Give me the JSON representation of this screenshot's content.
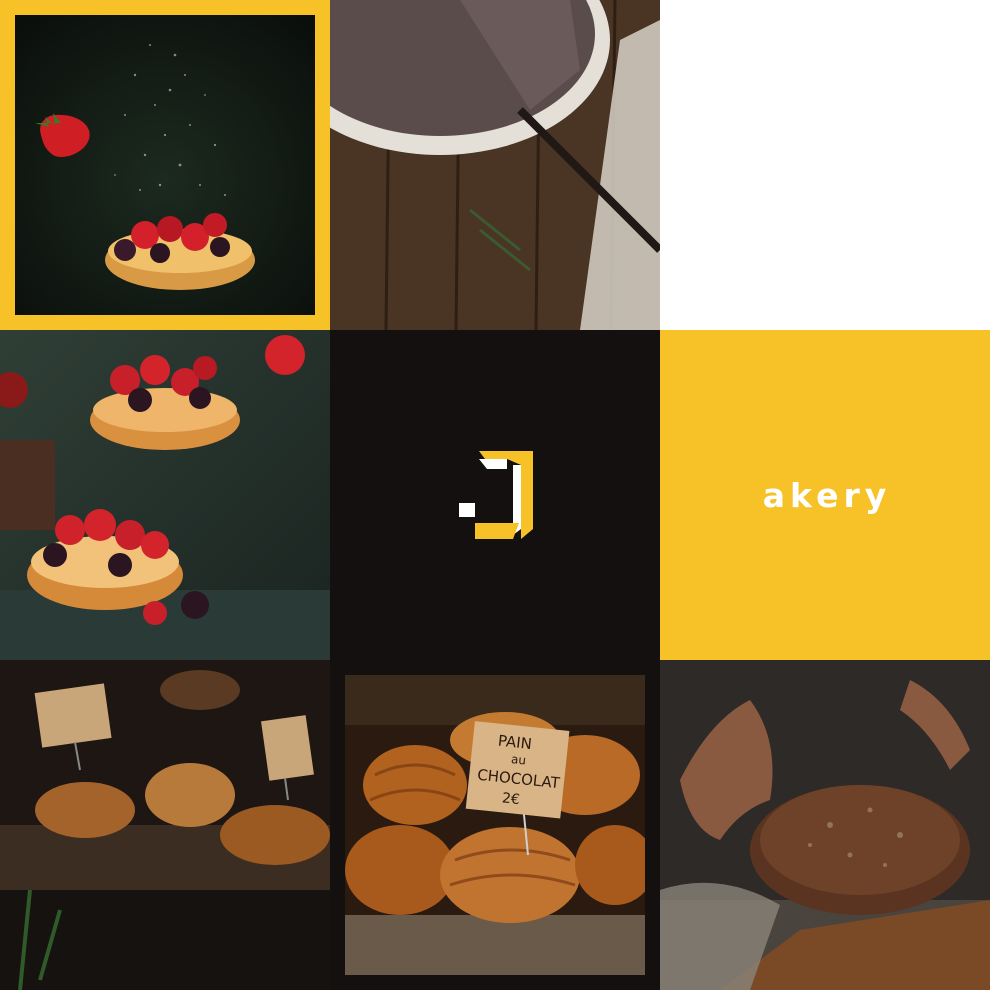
{
  "brand": {
    "name": "akery",
    "logo_icon": "j-monogram-icon",
    "accent_color": "#f6c227",
    "dark_color": "#141010"
  },
  "tiles": {
    "strawberry_tart": {
      "icon": "strawberry-tart-photo"
    },
    "chocolate_cake": {
      "icon": "chocolate-cake-photo"
    },
    "blank": {
      "icon": "blank-white-tile"
    },
    "berry_tarts": {
      "icon": "berry-tarts-photo"
    },
    "logo": {
      "icon": "logo-tile"
    },
    "brand": {
      "icon": "brand-name-tile"
    },
    "pastry_case": {
      "icon": "pastry-display-photo"
    },
    "pain_au_chocolat": {
      "icon": "pain-au-chocolat-photo"
    },
    "bread": {
      "icon": "sourdough-bread-photo"
    }
  },
  "signs": {
    "pain_au_chocolat": [
      "PAIN",
      "au",
      "CHOCOLAT",
      "2€"
    ]
  }
}
